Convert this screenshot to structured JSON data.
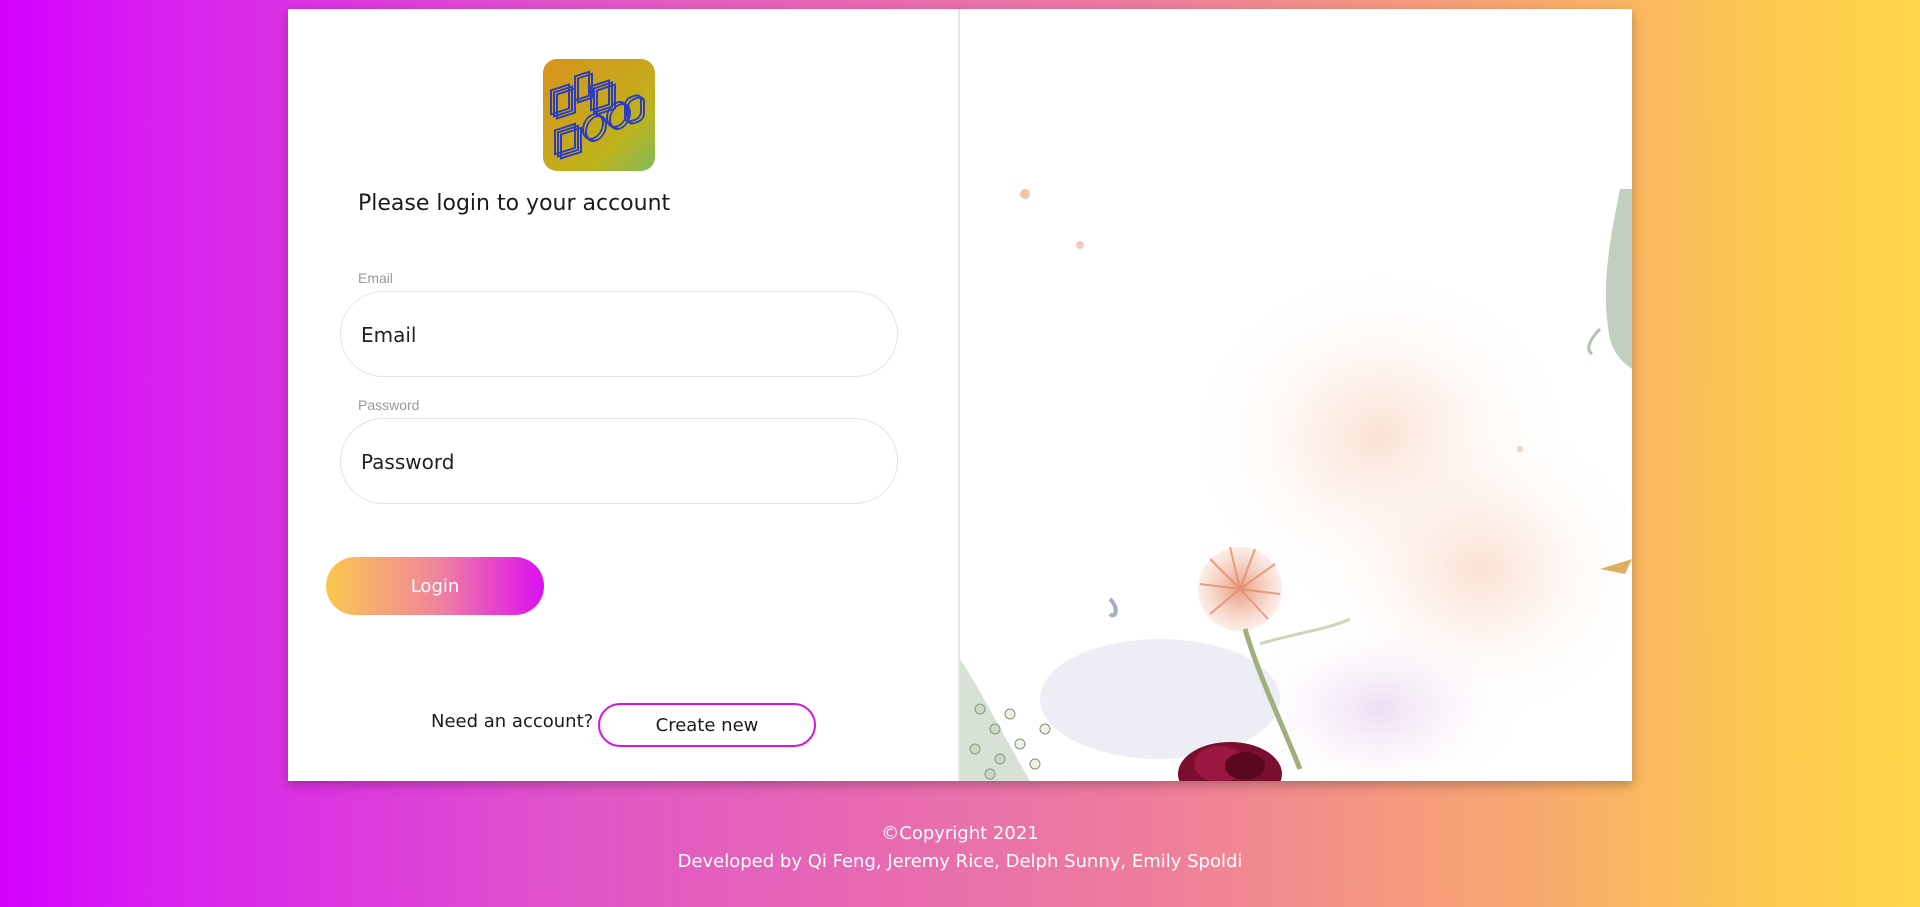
{
  "logo": {
    "alt": "Big Mood logo",
    "icon": "big-mood-logo-icon"
  },
  "login": {
    "heading": "Please login to your account",
    "email_label": "Email",
    "email_placeholder": "Email",
    "password_label": "Password",
    "password_placeholder": "Password",
    "login_button": "Login",
    "need_account_text": "Need an account?",
    "create_button": "Create new"
  },
  "footer": {
    "copyright": "©Copyright 2021",
    "developers": "Developed by Qi Feng, Jeremy Rice, Delph Sunny, Emily Spoldi"
  },
  "colors": {
    "bg_gradient_start": "#d400ff",
    "bg_gradient_end": "#ffd74a",
    "accent_magenta": "#d610e6",
    "accent_yellow": "#fbc64f"
  }
}
